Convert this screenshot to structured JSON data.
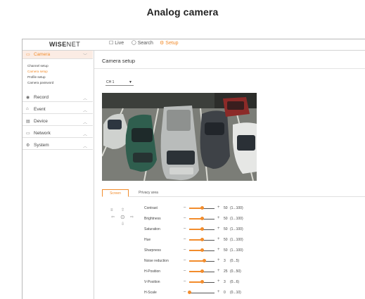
{
  "document": {
    "title": "Analog camera"
  },
  "topbar": {
    "logo": {
      "prefix": "WISE",
      "suffix": "NET"
    },
    "nav": [
      {
        "label": "Live",
        "icon": "monitor-icon",
        "glyph": "☐",
        "active": false
      },
      {
        "label": "Search",
        "icon": "search-icon",
        "glyph": "🔍︎",
        "active": false
      },
      {
        "label": "Setup",
        "icon": "gear-icon",
        "glyph": "⚙",
        "active": true
      }
    ]
  },
  "sidebar": {
    "sections": [
      {
        "label": "Camera",
        "icon": "camera-icon",
        "glyph": "▭",
        "chevron": "﹀",
        "open": true,
        "items": [
          {
            "label": "Channel setup",
            "active": false
          },
          {
            "label": "Camera setup",
            "active": true
          },
          {
            "label": "Profile setup",
            "active": false
          },
          {
            "label": "Camera password",
            "active": false
          }
        ]
      },
      {
        "label": "Record",
        "icon": "record-icon",
        "glyph": "◉",
        "chevron": "︿"
      },
      {
        "label": "Event",
        "icon": "event-icon",
        "glyph": "⌂",
        "chevron": "︿"
      },
      {
        "label": "Device",
        "icon": "device-icon",
        "glyph": "▤",
        "chevron": "︿"
      },
      {
        "label": "Network",
        "icon": "network-icon",
        "glyph": "▭",
        "chevron": "︿"
      },
      {
        "label": "System",
        "icon": "system-icon",
        "glyph": "⚙",
        "chevron": "︿"
      }
    ]
  },
  "main": {
    "title": "Camera setup",
    "channel": {
      "value": "CH 1",
      "caret": "▼"
    },
    "tabs": [
      {
        "label": "Screen",
        "active": true
      },
      {
        "label": "Privacy area",
        "active": false
      }
    ],
    "ptz": {
      "up": "⇧",
      "down": "⇩",
      "left": "⇦",
      "right": "⇨",
      "center": "⊙",
      "menu": "≡"
    },
    "settings": [
      {
        "name": "Contrast",
        "value": "50",
        "range": "(1...100)",
        "level": 0.5
      },
      {
        "name": "Brightness",
        "value": "50",
        "range": "(1...100)",
        "level": 0.5
      },
      {
        "name": "Saturation",
        "value": "50",
        "range": "(1...100)",
        "level": 0.5
      },
      {
        "name": "Hue",
        "value": "50",
        "range": "(1...100)",
        "level": 0.5
      },
      {
        "name": "Sharpness",
        "value": "50",
        "range": "(1...100)",
        "level": 0.5
      },
      {
        "name": "Noise reduction",
        "value": "3",
        "range": "(0...5)",
        "level": 0.6
      },
      {
        "name": "H-Position",
        "value": "25",
        "range": "(0...50)",
        "level": 0.5
      },
      {
        "name": "V-Position",
        "value": "3",
        "range": "(0...6)",
        "level": 0.5
      },
      {
        "name": "H-Scale",
        "value": "0",
        "range": "(0...10)",
        "level": 0.0
      }
    ],
    "slider": {
      "minus": "–",
      "plus": "+"
    }
  },
  "colors": {
    "accent": "#f28c2c",
    "border": "#d4d4d4"
  }
}
